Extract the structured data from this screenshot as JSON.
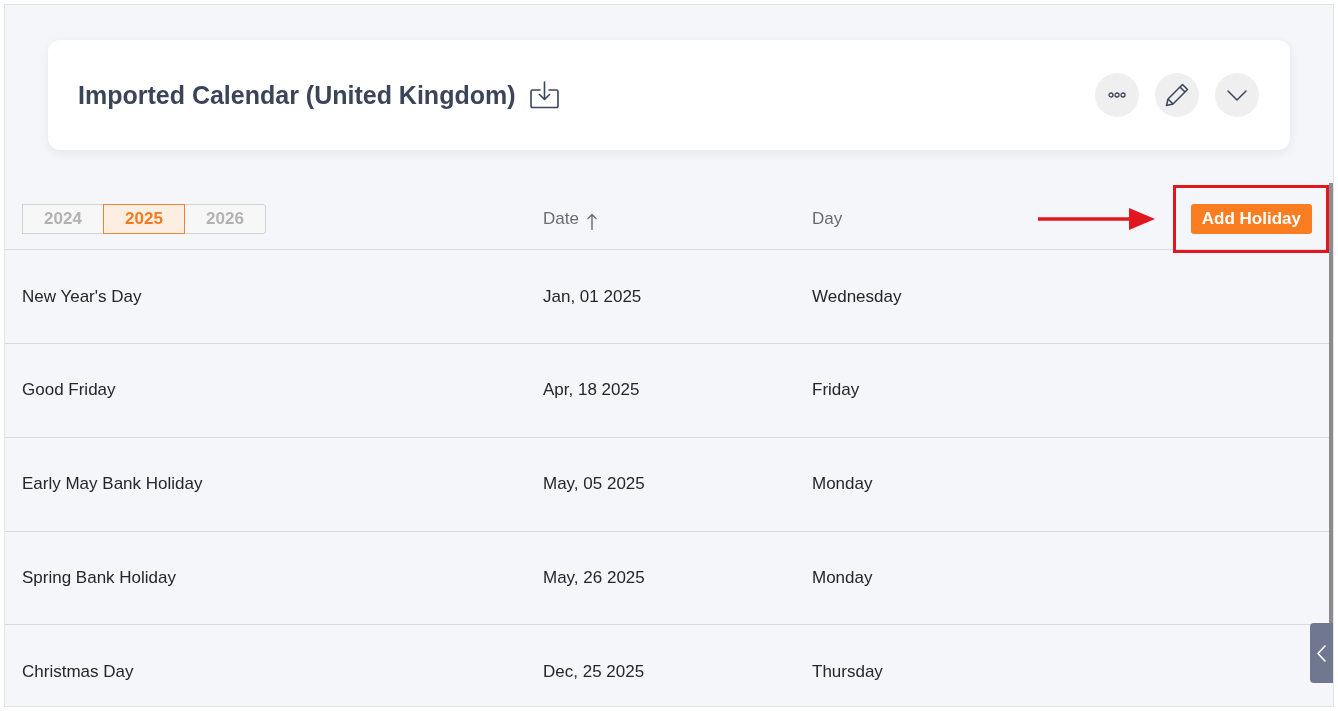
{
  "card": {
    "title": "Imported Calendar (United Kingdom)"
  },
  "years": [
    {
      "label": "2024",
      "selected": false
    },
    {
      "label": "2025",
      "selected": true
    },
    {
      "label": "2026",
      "selected": false
    }
  ],
  "table": {
    "columns": [
      {
        "label": "Date",
        "sorted": true
      },
      {
        "label": "Day",
        "sorted": false
      }
    ],
    "rows": [
      {
        "name": "New Year's Day",
        "date": "Jan, 01 2025",
        "day": "Wednesday"
      },
      {
        "name": "Good Friday",
        "date": "Apr, 18 2025",
        "day": "Friday"
      },
      {
        "name": "Early May Bank Holiday",
        "date": "May, 05 2025",
        "day": "Monday"
      },
      {
        "name": "Spring Bank Holiday",
        "date": "May, 26 2025",
        "day": "Monday"
      },
      {
        "name": "Christmas Day",
        "date": "Dec, 25 2025",
        "day": "Thursday"
      }
    ]
  },
  "add_button": {
    "label": "Add Holiday",
    "highlighted": true
  }
}
